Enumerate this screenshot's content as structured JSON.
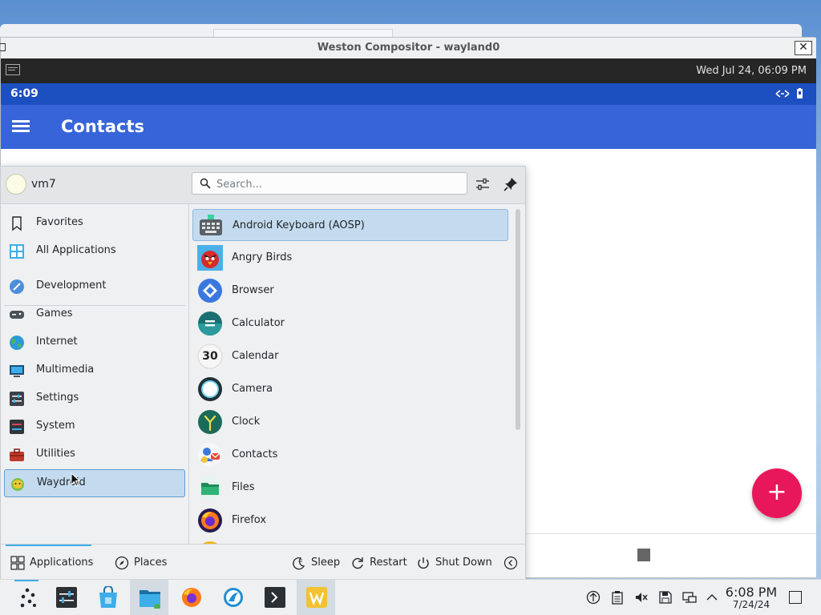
{
  "window": {
    "title": "Weston Compositor - wayland0",
    "close_glyph": "✕",
    "panel_clock": "Wed Jul 24, 06:09 PM"
  },
  "android": {
    "status_time": "6:09",
    "app_title": "Contacts",
    "fab_glyph": "+",
    "colors": {
      "status_bar": "#1c4fbf",
      "app_bar": "#3764d8",
      "fab": "#e8175b"
    }
  },
  "launcher": {
    "user_name": "vm7",
    "search_placeholder": "Search...",
    "categories": [
      {
        "label": "Favorites",
        "icon": "bookmark-icon"
      },
      {
        "label": "All Applications",
        "icon": "grid-icon"
      },
      {
        "label": "Development",
        "icon": "development-icon"
      },
      {
        "label": "Games",
        "icon": "gamepad-icon"
      },
      {
        "label": "Internet",
        "icon": "globe-icon"
      },
      {
        "label": "Multimedia",
        "icon": "multimedia-icon"
      },
      {
        "label": "Settings",
        "icon": "settings-icon"
      },
      {
        "label": "System",
        "icon": "system-icon"
      },
      {
        "label": "Utilities",
        "icon": "toolbox-icon"
      },
      {
        "label": "Waydroid",
        "icon": "waydroid-icon",
        "selected": true
      }
    ],
    "apps": [
      {
        "label": "Android Keyboard (AOSP)",
        "icon": "keyboard-icon",
        "selected": true
      },
      {
        "label": "Angry Birds",
        "icon": "angry-birds-icon"
      },
      {
        "label": "Browser",
        "icon": "browser-icon"
      },
      {
        "label": "Calculator",
        "icon": "calculator-icon"
      },
      {
        "label": "Calendar",
        "icon": "calendar-icon",
        "badge": "30"
      },
      {
        "label": "Camera",
        "icon": "camera-icon"
      },
      {
        "label": "Clock",
        "icon": "clock-icon"
      },
      {
        "label": "Contacts",
        "icon": "contacts-icon"
      },
      {
        "label": "Files",
        "icon": "files-icon"
      },
      {
        "label": "Firefox",
        "icon": "firefox-icon"
      }
    ],
    "footer": {
      "applications": "Applications",
      "places": "Places",
      "sleep": "Sleep",
      "restart": "Restart",
      "shutdown": "Shut Down"
    }
  },
  "taskbar": {
    "time": "6:08 PM",
    "date": "7/24/24",
    "apps": [
      "application-launcher-icon",
      "settings-app-icon",
      "discover-store-icon",
      "file-manager-icon",
      "firefox-icon",
      "waydroid-app-icon",
      "terminal-icon",
      "waydroid-weston-icon"
    ],
    "tray": [
      "vault-icon",
      "clipboard-icon",
      "volume-muted-icon",
      "save-icon",
      "network-icon",
      "chevron-up-icon"
    ]
  }
}
